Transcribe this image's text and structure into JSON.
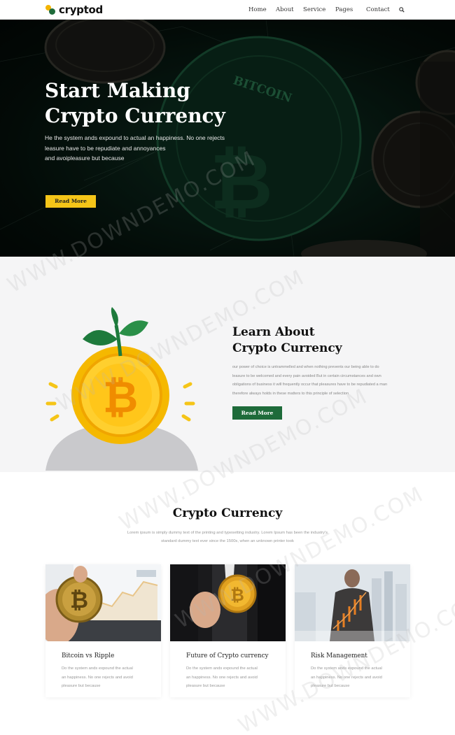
{
  "brand": {
    "name": "cryptod"
  },
  "nav": {
    "items": [
      {
        "label": "Home"
      },
      {
        "label": "About"
      },
      {
        "label": "Service"
      },
      {
        "label": "Pages"
      },
      {
        "label": "Contact"
      }
    ],
    "search_icon": "search-icon"
  },
  "hero": {
    "title_lines": [
      "Start Making",
      "Crypto Currency"
    ],
    "text_lines": [
      "He the system ands expound to actual an happiness. No one rejects",
      "leasure have to be repudiate and annoyances",
      "and avoipleasure but because"
    ],
    "button": "Read More",
    "coin_label": "BITCOIN"
  },
  "about": {
    "title_lines": [
      "Learn About",
      "Crypto Currency"
    ],
    "text_lines": [
      "our power of choice is untrammelled and when nothing prevents our being able to do",
      "leasure to be welcomed and every pain avoided But in certain circumstances and own",
      "obligations of business it will frequently occur that pleasures have to be repudiated a man",
      "therefore always holds in these matters to this principle of selection"
    ],
    "button": "Read More"
  },
  "crypto": {
    "title": "Crypto Currency",
    "subtitle_lines": [
      "Lorem ipsum is simply dummy text of the printing and typesetting industry. Lorem Ipsum has been the industry's",
      "standard dummy text ever since the 1500s, when an unknown printer took"
    ],
    "cards": [
      {
        "title": "Bitcoin vs Ripple",
        "text_lines": [
          "Do the system ands expound the actual",
          "an happiness. No one rejects and avoid",
          "pleasure but because"
        ]
      },
      {
        "title": "Future of Crypto currency",
        "text_lines": [
          "Do the system ands expound the actual",
          "an happiness. No one rejects and avoid",
          "pleasure but because"
        ]
      },
      {
        "title": "Risk Management",
        "text_lines": [
          "Do the system ands expound the actual",
          "an happiness. No one rejects and avoid",
          "pleasure but because"
        ]
      }
    ]
  },
  "watermark": "WWW.DOWNDEMO.COM",
  "colors": {
    "accent_yellow": "#f5c518",
    "accent_green": "#1e6b3a",
    "hero_dark": "#0a2218"
  }
}
